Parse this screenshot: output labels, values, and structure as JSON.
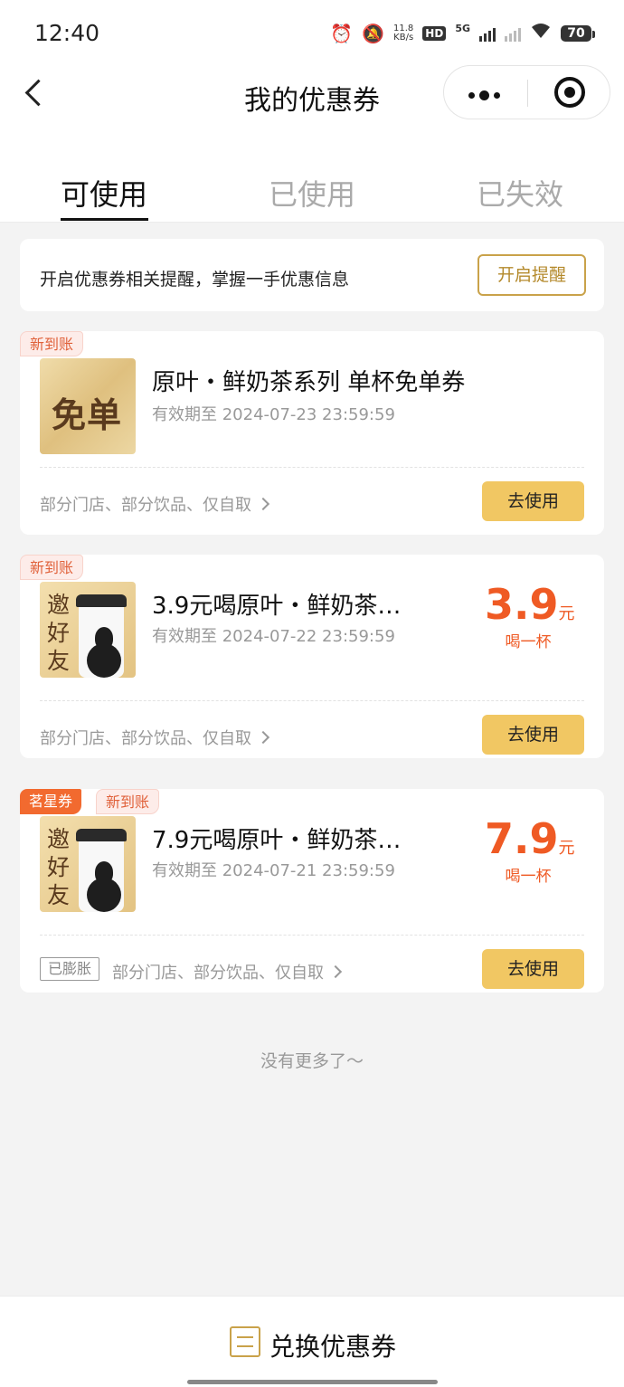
{
  "status_bar": {
    "time": "12:40",
    "net_speed_value": "11.8",
    "net_speed_unit": "KB/s",
    "hd_label": "HD",
    "network": "5G",
    "battery": "70"
  },
  "nav": {
    "title": "我的优惠券",
    "back_icon": "chevron-left-icon",
    "more_icon": "more-dots-icon",
    "close_icon": "target-circle-icon"
  },
  "tabs": [
    {
      "label": "可使用",
      "active": true
    },
    {
      "label": "已使用",
      "active": false
    },
    {
      "label": "已失效",
      "active": false
    }
  ],
  "notice": {
    "text": "开启优惠券相关提醒，掌握一手优惠信息",
    "button": "开启提醒"
  },
  "coupons": [
    {
      "tags": [
        "新到账"
      ],
      "thumb_text": "免单",
      "title": "原叶・鲜奶茶系列 单杯免单券",
      "validity": "有效期至 2024-07-23 23:59:59",
      "scope": "部分门店、部分饮品、仅自取",
      "button": "去使用"
    },
    {
      "tags": [
        "新到账"
      ],
      "thumb_text": "邀好友",
      "title": "3.9元喝原叶・鲜奶茶…",
      "validity": "有效期至 2024-07-22 23:59:59",
      "price": "3.9",
      "price_unit": "元",
      "price_sub": "喝一杯",
      "scope": "部分门店、部分饮品、仅自取",
      "button": "去使用"
    },
    {
      "tags": [
        "茗星券",
        "新到账"
      ],
      "thumb_text": "邀好友",
      "title": "7.9元喝原叶・鲜奶茶…",
      "validity": "有效期至 2024-07-21 23:59:59",
      "price": "7.9",
      "price_unit": "元",
      "price_sub": "喝一杯",
      "badge": "已膨胀",
      "scope": "部分门店、部分饮品、仅自取",
      "button": "去使用"
    }
  ],
  "footer_text": "没有更多了～",
  "bottom_bar": {
    "icon": "exchange-icon",
    "label": "兑换优惠券"
  },
  "colors": {
    "accent_gold": "#f1c763",
    "price_orange": "#ef5a24",
    "tag_orange": "#f26a2f"
  }
}
